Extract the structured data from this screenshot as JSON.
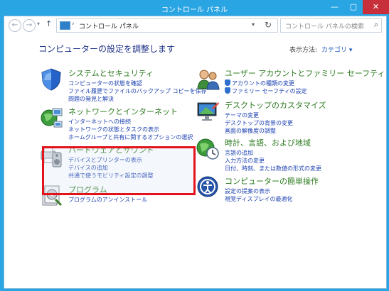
{
  "window": {
    "title": "コントロール パネル",
    "minimize": "—",
    "maximize": "▢",
    "close": "✕"
  },
  "toolbar": {
    "back": "←",
    "forward": "→",
    "recent": "▾",
    "up": "↑",
    "address_sep": "›",
    "address_text": "コントロール パネル",
    "address_sep2": "›",
    "address_dropdown": "▾",
    "refresh": "↻",
    "search_placeholder": "コントロール パネルの検索",
    "search_icon": "⌕"
  },
  "main": {
    "heading": "コンピューターの設定を調整します",
    "view_by_label": "表示方法:",
    "view_by_value": "カテゴリ ▾"
  },
  "categories_left": [
    {
      "title": "システムとセキュリティ",
      "links": [
        "コンピューターの状態を確認",
        "ファイル履歴でファイルのバックアップ コピーを保存",
        "問題の発見と解決"
      ],
      "icon": "shield-icon"
    },
    {
      "title": "ネットワークとインターネット",
      "links": [
        "インターネットへの接続",
        "ネットワークの状態とタスクの表示",
        "ホームグループと共有に関するオプションの選択"
      ],
      "icon": "network-globe-icon"
    },
    {
      "title": "ハードウェアとサウンド",
      "links": [
        "デバイスとプリンターの表示",
        "デバイスの追加",
        "共通で使うモビリティ設定の調整"
      ],
      "icon": "printer-speaker-icon"
    },
    {
      "title": "プログラム",
      "links": [
        "プログラムのアンインストール"
      ],
      "icon": "programs-icon"
    }
  ],
  "categories_right": [
    {
      "title": "ユーザー アカウントとファミリー セーフティ",
      "links": [
        "アカウントの種類の変更",
        "ファミリー セーフティの設定"
      ],
      "icon": "users-icon"
    },
    {
      "title": "デスクトップのカスタマイズ",
      "links": [
        "テーマの変更",
        "デスクトップの背景の変更",
        "画面の解像度の調整"
      ],
      "icon": "desktop-icon"
    },
    {
      "title": "時計、言語、および地域",
      "links": [
        "言語の追加",
        "入力方法の変更",
        "日付、時刻、または数値の形式の変更"
      ],
      "icon": "clock-globe-icon"
    },
    {
      "title": "コンピューターの簡単操作",
      "links": [
        "設定の提案の表示",
        "視覚ディスプレイの最適化"
      ],
      "icon": "ease-of-access-icon"
    }
  ],
  "colors": {
    "title_bar": "#2aa5e3",
    "category_title": "#2c7b1f",
    "link": "#1a3fb0",
    "heading": "#1e3287",
    "highlight": "#e3121b"
  }
}
